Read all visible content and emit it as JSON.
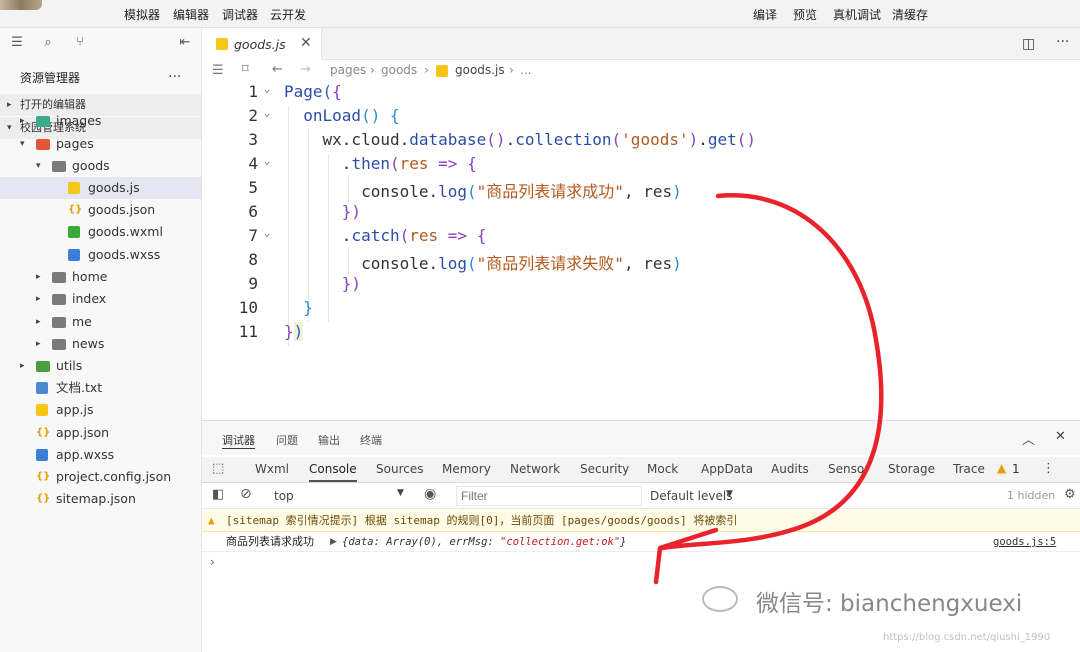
{
  "toolbar": {
    "left_buttons": [
      "模拟器",
      "编辑器",
      "调试器",
      "云开发"
    ],
    "right_buttons": [
      "编译",
      "预览",
      "真机调试",
      "清缓存"
    ]
  },
  "sidebar": {
    "title": "资源管理器",
    "more": "...",
    "open_editors": "打开的编辑器",
    "project": "校园管理系统",
    "items": [
      {
        "label": "images",
        "type": "folder"
      },
      {
        "label": "pages",
        "type": "folder"
      },
      {
        "label": "goods",
        "type": "folder"
      },
      {
        "label": "goods.js",
        "type": "js"
      },
      {
        "label": "goods.json",
        "type": "json"
      },
      {
        "label": "goods.wxml",
        "type": "wxml"
      },
      {
        "label": "goods.wxss",
        "type": "wxss"
      },
      {
        "label": "home",
        "type": "folder"
      },
      {
        "label": "index",
        "type": "folder"
      },
      {
        "label": "me",
        "type": "folder"
      },
      {
        "label": "news",
        "type": "folder"
      },
      {
        "label": "utils",
        "type": "folder"
      },
      {
        "label": "文档.txt",
        "type": "txt"
      },
      {
        "label": "app.js",
        "type": "js"
      },
      {
        "label": "app.json",
        "type": "json"
      },
      {
        "label": "app.wxss",
        "type": "wxss"
      },
      {
        "label": "project.config.json",
        "type": "json"
      },
      {
        "label": "sitemap.json",
        "type": "json"
      }
    ]
  },
  "editor": {
    "tab": "goods.js",
    "breadcrumb": [
      "pages",
      "goods",
      "goods.js",
      "..."
    ],
    "line_numbers": [
      "1",
      "2",
      "3",
      "4",
      "5",
      "6",
      "7",
      "8",
      "9",
      "10",
      "11"
    ]
  },
  "devtools": {
    "top_tabs": [
      "调试器",
      "问题",
      "输出",
      "终端"
    ],
    "tabs": [
      "Wxml",
      "Console",
      "Sources",
      "Memory",
      "Network",
      "Security",
      "Mock",
      "AppData",
      "Audits",
      "Sensor",
      "Storage",
      "Trace"
    ],
    "warning_count": "1",
    "context": "top",
    "filter_placeholder": "Filter",
    "levels": "Default levels",
    "hidden": "1 hidden",
    "warning_text": "[sitemap 索引情况提示] 根据 sitemap 的规则[0]，当前页面 [pages/goods/goods] 将被索引",
    "log_message": "商品列表请求成功",
    "log_object_prefix": "{data: Array(0), errMsg: ",
    "log_object_value": "\"collection.get:ok\"",
    "log_object_suffix": "}",
    "log_source": "goods.js:5"
  },
  "watermark": {
    "wechat": "微信号: bianchengxuexi",
    "url": "https://blog.csdn.net/qiushi_1990"
  },
  "colors": {
    "annotation": "#e8232b",
    "selected_row": "#e4e6f1"
  }
}
